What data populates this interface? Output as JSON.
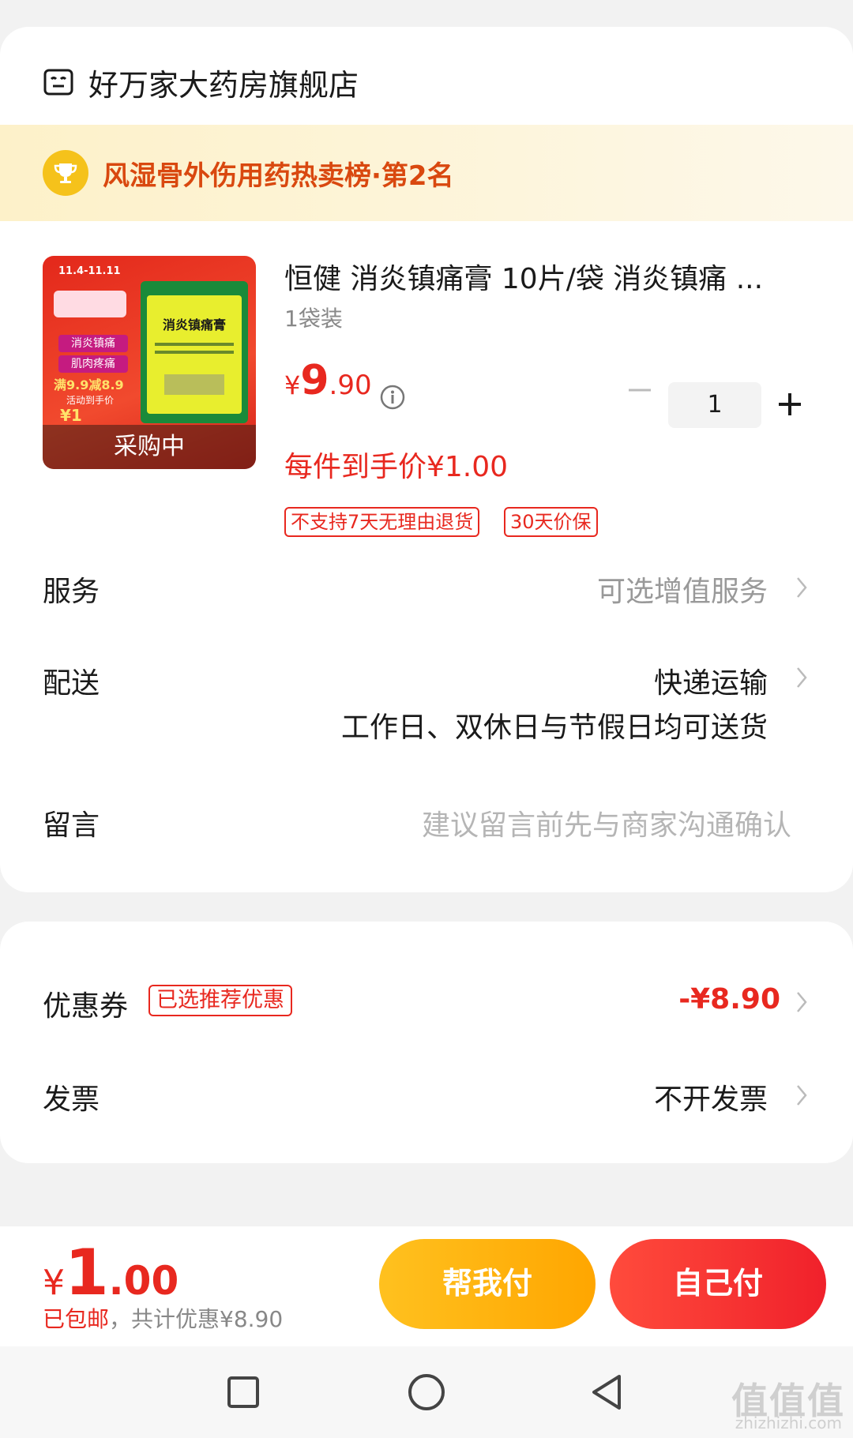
{
  "store": {
    "name": "好万家大药房旗舰店",
    "icon": "store-icon"
  },
  "ranking": {
    "text": "风湿骨外伤用药热卖榜·第2名",
    "icon": "trophy-icon"
  },
  "product": {
    "title": "恒健 消炎镇痛膏 10片/袋 消炎镇痛 ...",
    "spec": "1袋装",
    "price_symbol": "¥",
    "price_int": "9",
    "price_dec": ".90",
    "final_price": "每件到手价¥1.00",
    "quantity": "1",
    "thumbnail": {
      "badge": "采购中",
      "promo_date": "11.4-11.11",
      "chip1": "消炎镇痛",
      "chip2": "肌肉疼痛",
      "promo_deal": "满9.9减8.9",
      "promo_note": "活动到手价",
      "promo_price": "¥1",
      "package_title": "消炎镇痛膏"
    },
    "tags": [
      "不支持7天无理由退货",
      "30天价保"
    ]
  },
  "service": {
    "label": "服务",
    "value": "可选增值服务"
  },
  "delivery": {
    "label": "配送",
    "value": "快递运输",
    "note": "工作日、双休日与节假日均可送货"
  },
  "message": {
    "label": "留言",
    "placeholder": "建议留言前先与商家沟通确认"
  },
  "coupon": {
    "label": "优惠券",
    "badge": "已选推荐优惠",
    "value": "-¥8.90"
  },
  "invoice": {
    "label": "发票",
    "value": "不开发票"
  },
  "footer": {
    "total_symbol": "¥",
    "total_int": "1",
    "total_dec": ".00",
    "shipping": "已包邮",
    "discount": "，共计优惠¥8.90",
    "help_pay": "帮我付",
    "self_pay": "自己付"
  },
  "watermark": {
    "main": "值值值",
    "sub": "zhizhizhi.com"
  },
  "colors": {
    "accent": "#e8281f",
    "gold": "#ffb300",
    "banner": "#fdf1c9"
  }
}
